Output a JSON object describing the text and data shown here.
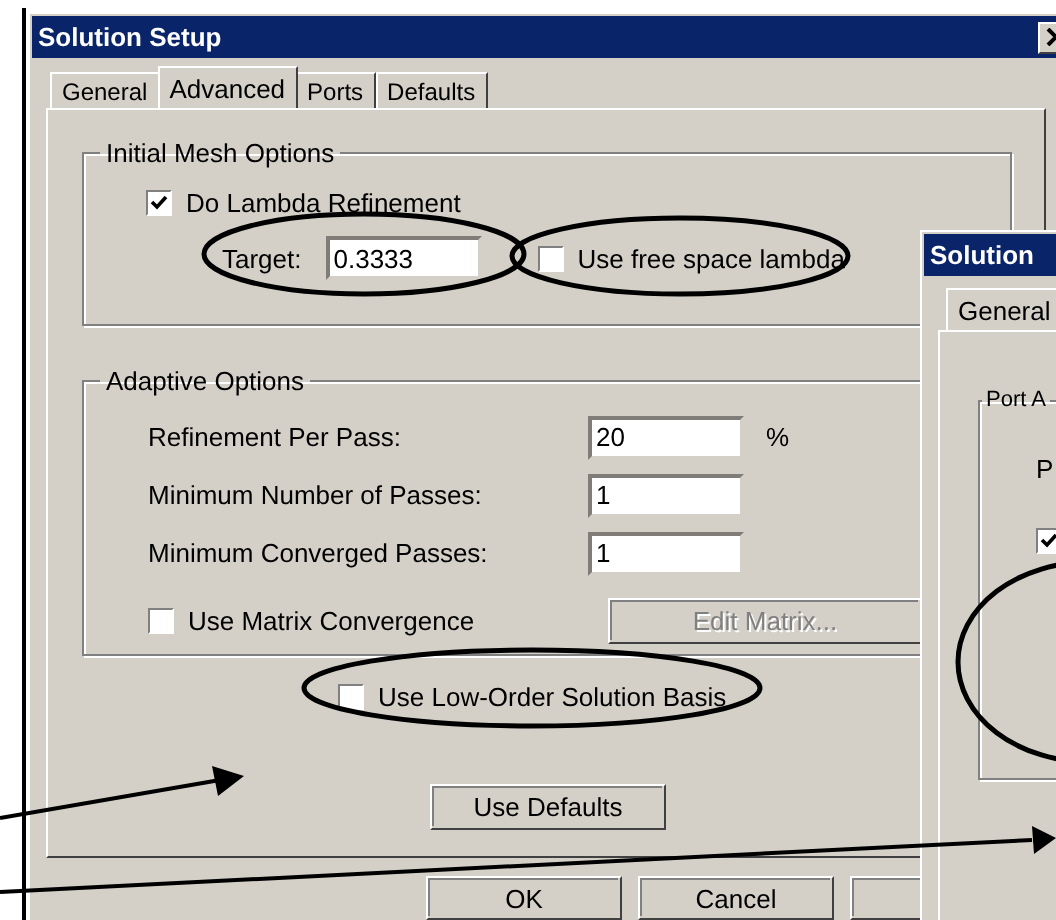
{
  "main_window": {
    "title": "Solution Setup",
    "tabs": [
      {
        "label": "General",
        "selected": false
      },
      {
        "label": "Advanced",
        "selected": true
      },
      {
        "label": "Ports",
        "selected": false
      },
      {
        "label": "Defaults",
        "selected": false
      }
    ],
    "initial_mesh_options": {
      "title": "Initial Mesh Options",
      "lambda_refinement": {
        "label": "Do Lambda Refinement",
        "checked": true
      },
      "target": {
        "label": "Target:",
        "value": "0.3333"
      },
      "free_space_lambda": {
        "label": "Use free space lambda",
        "checked": false
      }
    },
    "adaptive_options": {
      "title": "Adaptive Options",
      "fields": [
        {
          "label": "Refinement Per Pass:",
          "value": "20",
          "unit": "%"
        },
        {
          "label": "Minimum Number of Passes:",
          "value": "1"
        },
        {
          "label": "Minimum Converged Passes:",
          "value": "1"
        }
      ],
      "matrix_convergence": {
        "label": "Use Matrix Convergence",
        "checked": false
      },
      "edit_matrix_button": {
        "label": "Edit Matrix...",
        "disabled": true
      }
    },
    "low_order_basis": {
      "label": "Use Low-Order Solution Basis",
      "checked": false
    },
    "use_defaults_button": "Use Defaults",
    "buttons": [
      "OK",
      "Cancel"
    ]
  },
  "second_window": {
    "title": "Solution",
    "tabs": [
      {
        "label": "General",
        "selected": true
      }
    ],
    "group_title": "Port A",
    "row_label": "P",
    "checkbox": {
      "checked": true
    }
  }
}
